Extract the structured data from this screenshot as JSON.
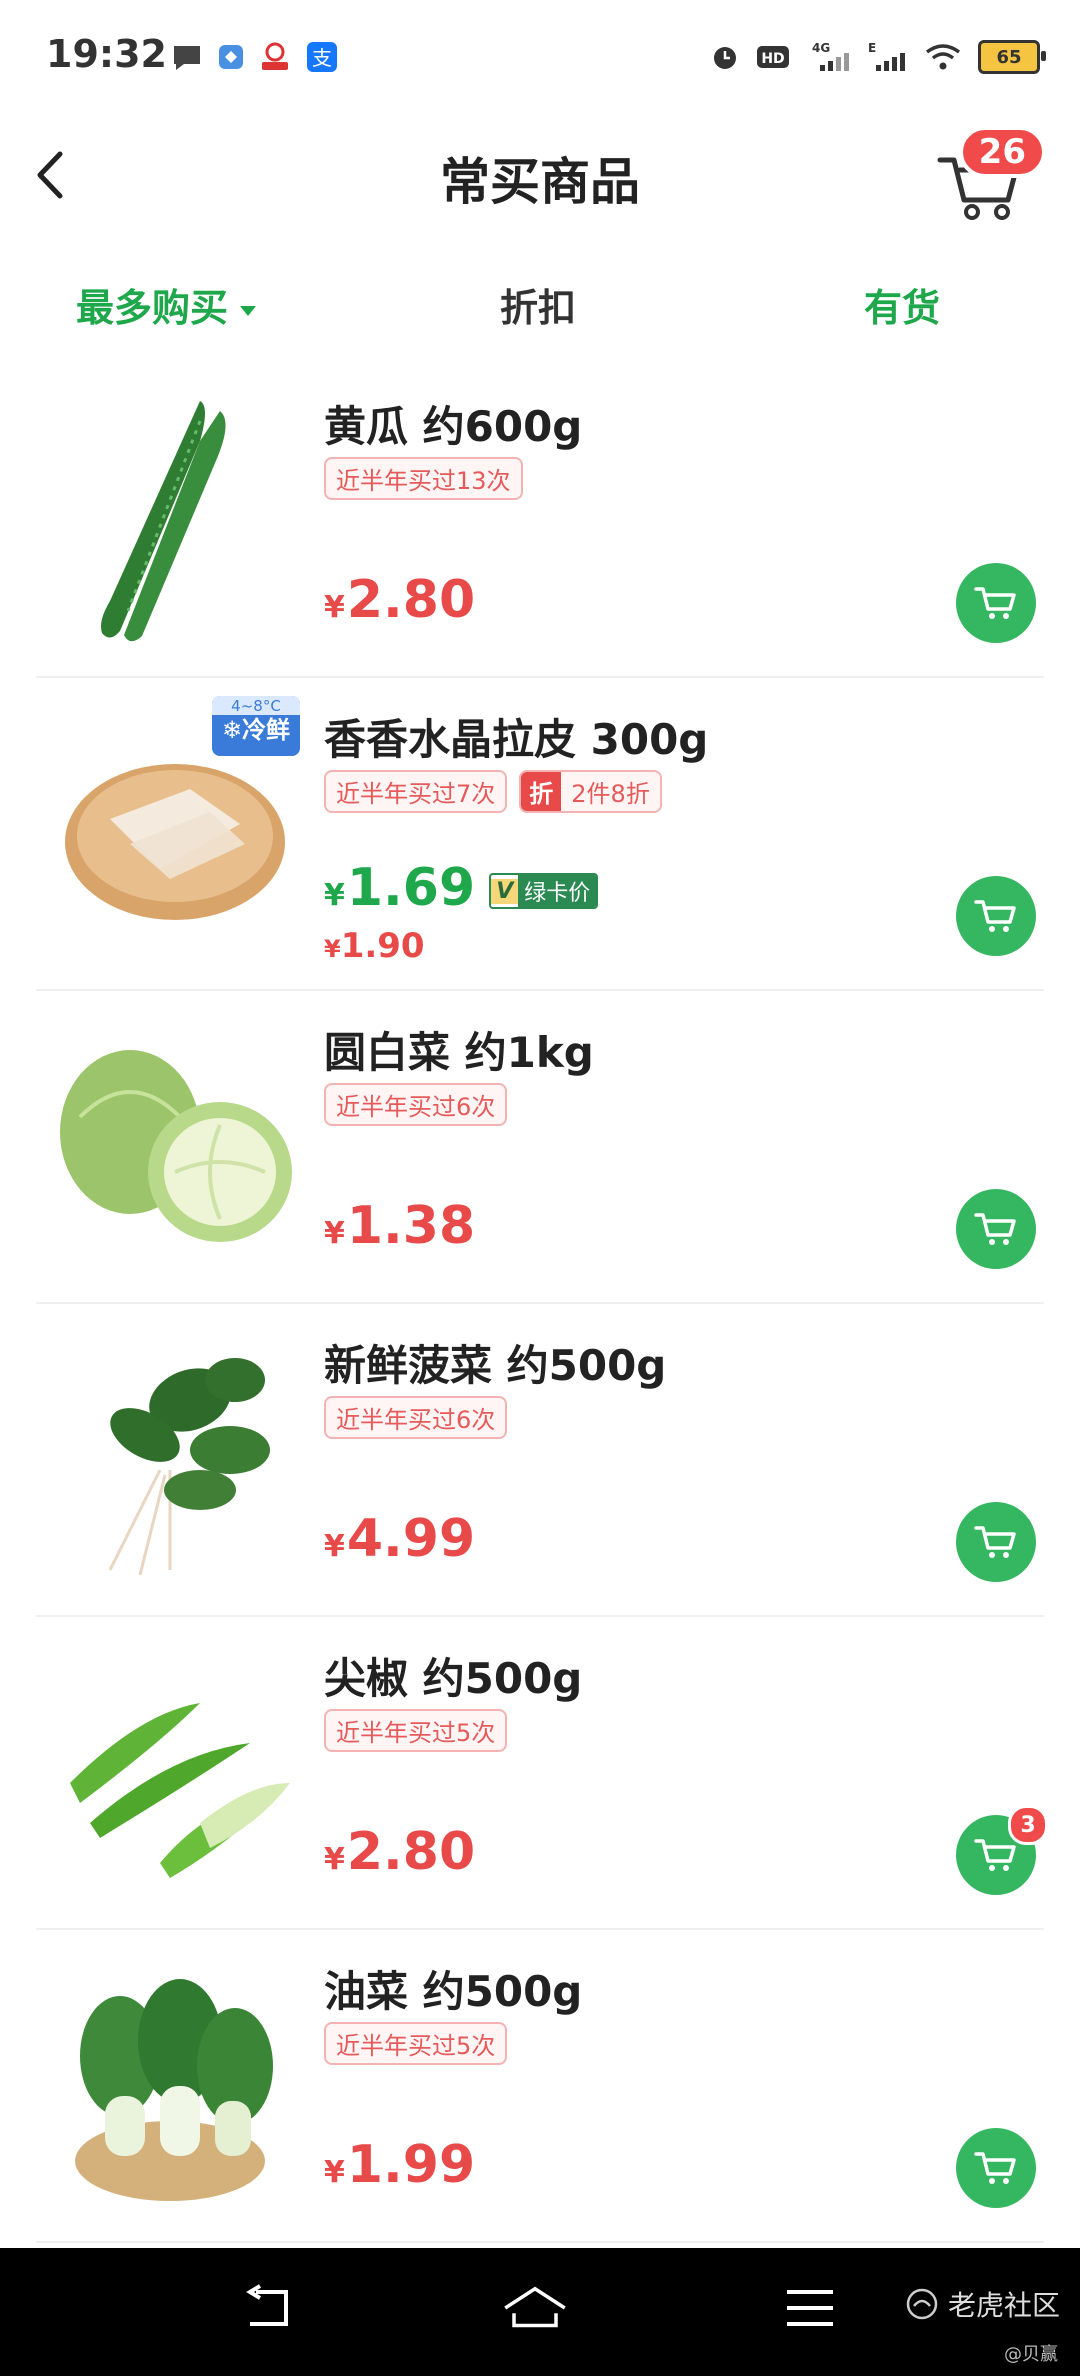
{
  "status_bar": {
    "time": "19:32",
    "battery": "65"
  },
  "header": {
    "title": "常买商品",
    "cart_count": "26"
  },
  "filters": {
    "most_bought": "最多购买",
    "discount": "折扣",
    "in_stock": "有货"
  },
  "products": [
    {
      "name": "黄瓜 约600g",
      "tag": "近半年买过13次",
      "price": "2.80"
    },
    {
      "name": "香香水晶拉皮 300g",
      "tag": "近半年买过7次",
      "promo_flag": "折",
      "promo_text": "2件8折",
      "price": "1.69",
      "vip_label": "绿卡价",
      "orig_price": "1.90",
      "cold_temp": "4~8°C",
      "cold_label": "❄冷鲜"
    },
    {
      "name": "圆白菜 约1kg",
      "tag": "近半年买过6次",
      "price": "1.38"
    },
    {
      "name": "新鲜菠菜 约500g",
      "tag": "近半年买过6次",
      "price": "4.99"
    },
    {
      "name": "尖椒 约500g",
      "tag": "近半年买过5次",
      "price": "2.80",
      "cart_qty": "3"
    },
    {
      "name": "油菜 约500g",
      "tag": "近半年买过5次",
      "price": "1.99"
    }
  ],
  "currency": "¥",
  "watermark": {
    "brand": "老虎社区",
    "user": "@贝赢"
  }
}
